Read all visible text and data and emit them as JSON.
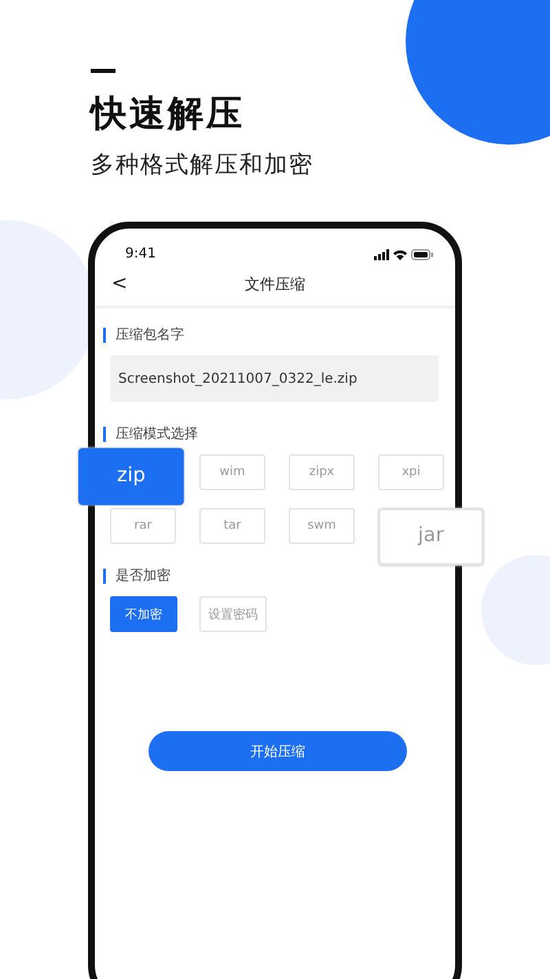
{
  "headline": {
    "title": "快速解压",
    "subtitle": "多种格式解压和加密"
  },
  "phone": {
    "status_bar": {
      "time": "9:41"
    },
    "nav": {
      "back": "<",
      "title": "文件压缩"
    },
    "name_section": {
      "label": "压缩包名字",
      "value": "Screenshot_20211007_0322_le.zip"
    },
    "format_section": {
      "label": "压缩模式选择",
      "formats": [
        {
          "label": "zip",
          "selected": true,
          "enlarged": true
        },
        {
          "label": "wim",
          "selected": false,
          "enlarged": false
        },
        {
          "label": "zipx",
          "selected": false,
          "enlarged": false
        },
        {
          "label": "xpi",
          "selected": false,
          "enlarged": false
        },
        {
          "label": "rar",
          "selected": false,
          "enlarged": false
        },
        {
          "label": "tar",
          "selected": false,
          "enlarged": false
        },
        {
          "label": "swm",
          "selected": false,
          "enlarged": false
        },
        {
          "label": "jar",
          "selected": false,
          "enlarged": true
        }
      ]
    },
    "encrypt_section": {
      "label": "是否加密",
      "options": [
        {
          "label": "不加密",
          "selected": true
        },
        {
          "label": "设置密码",
          "selected": false
        }
      ]
    },
    "start_button": "开始压缩"
  }
}
